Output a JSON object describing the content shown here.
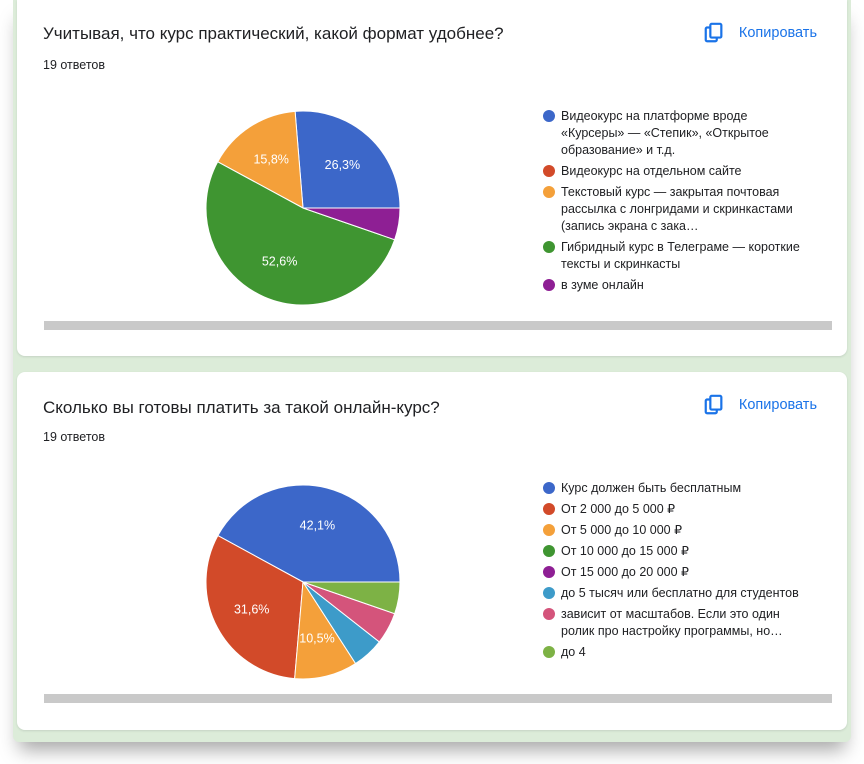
{
  "copy_label": "Копировать",
  "colors": {
    "blue": "#3c67c9",
    "red": "#d24a29",
    "orange": "#f4a03a",
    "green": "#3f9531",
    "purple": "#8e1f94",
    "teal": "#3d9bc9",
    "pink": "#d4547b",
    "lime": "#7db245",
    "link": "#1a73e8"
  },
  "chart_data": [
    {
      "type": "pie",
      "title": "Учитывая, что курс практический, какой формат удобнее?",
      "response_count": "19 ответов",
      "series": [
        {
          "name": "Видеокурс на платформе вроде «Курсеры» — «Степик», «Открытое образование» и т.д.",
          "value": 26.3,
          "label": "26,3%",
          "color": "#3c67c9"
        },
        {
          "name": "Видеокурс на отдельном сайте",
          "value": 0,
          "label": "",
          "color": "#d24a29"
        },
        {
          "name": "Текстовый курс — закрытая почтовая рассылка с лонгридами и скринкастами (запись экрана с зака…",
          "value": 15.8,
          "label": "15,8%",
          "color": "#f4a03a"
        },
        {
          "name": "Гибридный курс в Телеграме — короткие тексты и скринкасты",
          "value": 52.6,
          "label": "52,6%",
          "color": "#3f9531"
        },
        {
          "name": "в зуме онлайн",
          "value": 5.3,
          "label": "",
          "color": "#8e1f94"
        }
      ]
    },
    {
      "type": "pie",
      "title": "Сколько вы готовы платить за такой онлайн-курс?",
      "response_count": "19 ответов",
      "series": [
        {
          "name": "Курс должен быть бесплатным",
          "value": 42.1,
          "label": "42,1%",
          "color": "#3c67c9"
        },
        {
          "name": "От 2 000 до 5 000 ₽",
          "value": 31.6,
          "label": "31,6%",
          "color": "#d24a29"
        },
        {
          "name": "От 5 000 до 10 000 ₽",
          "value": 10.5,
          "label": "10,5%",
          "color": "#f4a03a"
        },
        {
          "name": "От 10 000 до 15 000 ₽",
          "value": 0,
          "label": "",
          "color": "#3f9531"
        },
        {
          "name": "От 15 000 до 20 000 ₽",
          "value": 0,
          "label": "",
          "color": "#8e1f94"
        },
        {
          "name": "до 5 тысяч или бесплатно для студентов",
          "value": 5.3,
          "label": "",
          "color": "#3d9bc9"
        },
        {
          "name": "зависит от масштабов. Если это один ролик про настройку программы, но…",
          "value": 5.3,
          "label": "",
          "color": "#d4547b"
        },
        {
          "name": "до 4",
          "value": 5.3,
          "label": "",
          "color": "#7db245"
        }
      ]
    }
  ]
}
